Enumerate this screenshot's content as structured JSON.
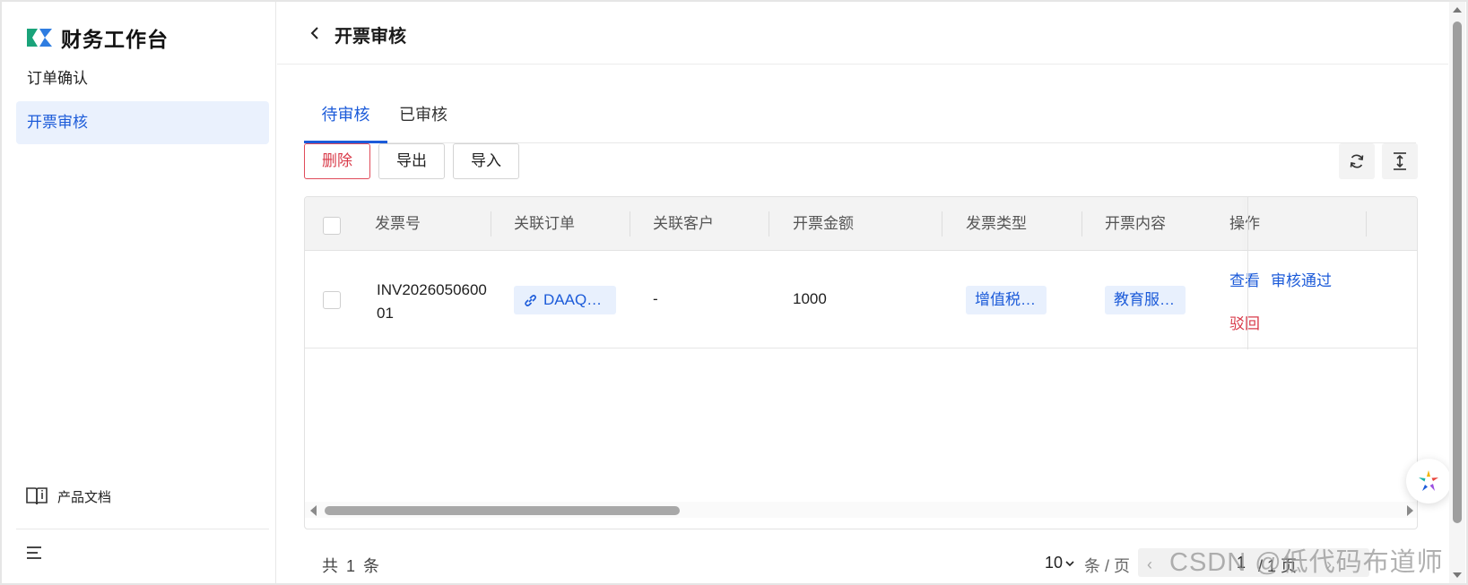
{
  "app": {
    "title": "财务工作台"
  },
  "sidebar": {
    "items": [
      {
        "label": "订单确认"
      },
      {
        "label": "开票审核"
      }
    ],
    "doc_link": "产品文档"
  },
  "header": {
    "title": "开票审核"
  },
  "tabs": [
    {
      "label": "待审核"
    },
    {
      "label": "已审核"
    }
  ],
  "toolbar": {
    "delete_label": "删除",
    "export_label": "导出",
    "import_label": "导入"
  },
  "table": {
    "columns": [
      "发票号",
      "关联订单",
      "关联客户",
      "开票金额",
      "发票类型",
      "开票内容",
      "操作"
    ],
    "rows": [
      {
        "invoice_no": "INV202605060001",
        "order": "DAAQ…",
        "customer": "-",
        "amount": "1000",
        "invoice_type": "增值税…",
        "content": "教育服…",
        "actions": {
          "view": "查看",
          "approve": "审核通过",
          "reject": "驳回"
        }
      }
    ]
  },
  "footer": {
    "total_text": "共 1 条",
    "page_size": "10",
    "page_size_unit": "条 / 页",
    "current_page": "1",
    "total_pages": "/ 1 页"
  },
  "watermark": "CSDN @低代码布道师",
  "colors": {
    "primary": "#1c5bd9",
    "danger": "#d93b4a",
    "active_bg": "#eaf1fd"
  }
}
